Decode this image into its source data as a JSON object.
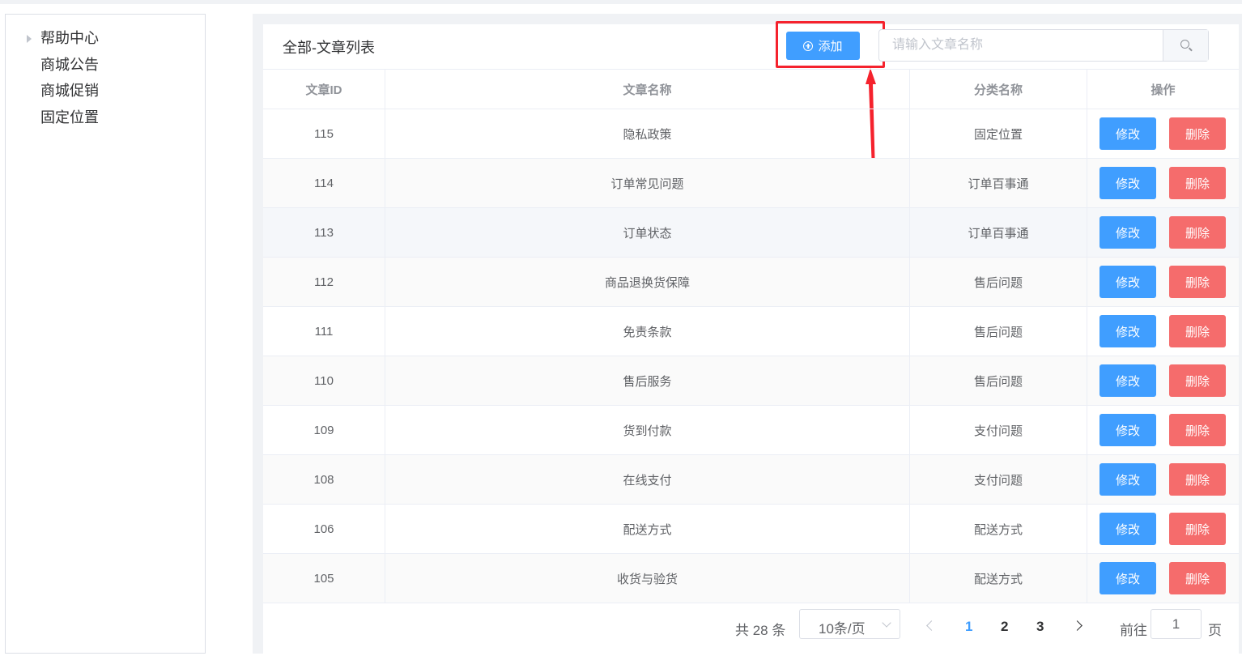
{
  "sidebar": {
    "items": [
      {
        "label": "帮助中心",
        "has_children": true
      },
      {
        "label": "商城公告"
      },
      {
        "label": "商城促销"
      },
      {
        "label": "固定位置"
      }
    ]
  },
  "main": {
    "title": "全部-文章列表",
    "add_label": "添加",
    "search_placeholder": "请输入文章名称",
    "columns": [
      "文章ID",
      "文章名称",
      "分类名称",
      "操作"
    ],
    "edit_label": "修改",
    "delete_label": "删除",
    "rows": [
      {
        "id": "115",
        "name": "隐私政策",
        "category": "固定位置"
      },
      {
        "id": "114",
        "name": "订单常见问题",
        "category": "订单百事通"
      },
      {
        "id": "113",
        "name": "订单状态",
        "category": "订单百事通"
      },
      {
        "id": "112",
        "name": "商品退换货保障",
        "category": "售后问题"
      },
      {
        "id": "111",
        "name": "免责条款",
        "category": "售后问题"
      },
      {
        "id": "110",
        "name": "售后服务",
        "category": "售后问题"
      },
      {
        "id": "109",
        "name": "货到付款",
        "category": "支付问题"
      },
      {
        "id": "108",
        "name": "在线支付",
        "category": "支付问题"
      },
      {
        "id": "106",
        "name": "配送方式",
        "category": "配送方式"
      },
      {
        "id": "105",
        "name": "收货与验货",
        "category": "配送方式"
      }
    ]
  },
  "pagination": {
    "total_text": "共 28 条",
    "page_size": "10条/页",
    "pages": [
      "1",
      "2",
      "3"
    ],
    "current_page": "1",
    "goto_label": "前往",
    "goto_value": "1",
    "page_suffix": "页"
  }
}
